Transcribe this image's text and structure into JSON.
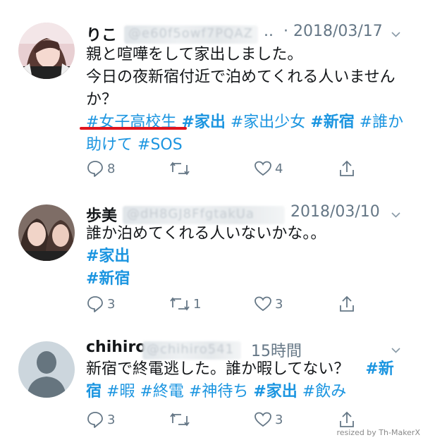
{
  "tweets": [
    {
      "name": "りこ",
      "handle_blurred": "@e60f5owf7PQAZ",
      "ellipsis": "..",
      "date": "· 2018/03/17",
      "lines": [
        "親と喧嘩をして家出しました。",
        "今日の夜新宿付近で泊めてくれる人いません",
        "か？"
      ],
      "hashtags_line1": [
        "#女子高校生",
        "#家出",
        "#家出少女",
        "#新宿",
        "#誰か"
      ],
      "hashtags_line2": [
        "助けて",
        "#SOS"
      ],
      "replies": "8",
      "retweets": "",
      "likes": "4"
    },
    {
      "name": "歩美",
      "handle_blurred": "@dH8GJ8FfgtakUa",
      "date": "2018/03/10",
      "lines": [
        "誰か泊めてくれる人いないかな。。"
      ],
      "hashtags": [
        "#家出",
        "#新宿"
      ],
      "replies": "3",
      "retweets": "1",
      "likes": "3"
    },
    {
      "name": "chihiro",
      "handle_blurred": "@chihiro541",
      "date": "15時間",
      "line1_text": "新宿で終電逃した。誰か暇してない？",
      "line1_tag": "#新",
      "line2_tagcont": "宿",
      "hashtags_line2": [
        "#暇",
        "#終電",
        "#神待ち",
        "#家出",
        "#飲み"
      ],
      "replies": "3",
      "retweets": "",
      "likes": "3"
    }
  ],
  "watermark": "resized by Th-MakerX",
  "colors": {
    "link": "#1b95e0",
    "muted": "#657786",
    "underline": "#e0141e"
  }
}
